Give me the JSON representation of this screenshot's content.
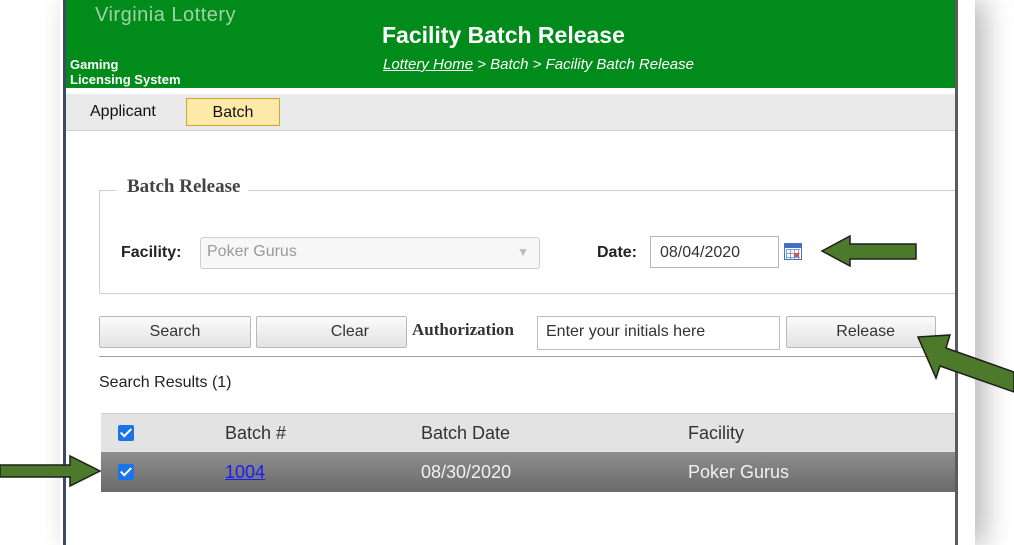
{
  "header": {
    "brand_top": "Virginia Lottery",
    "brand_sub_line1": "Gaming",
    "brand_sub_line2": "Licensing System",
    "page_title": "Facility Batch Release",
    "breadcrumb_home": "Lottery Home",
    "breadcrumb_rest": " > Batch > Facility Batch Release"
  },
  "menu": {
    "items": [
      {
        "label": "Applicant"
      },
      {
        "label": "Batch",
        "active": true
      }
    ]
  },
  "batch_release": {
    "legend": "Batch Release",
    "facility_label": "Facility:",
    "facility_value": "Poker Gurus",
    "date_label": "Date:",
    "date_value": "08/04/2020"
  },
  "actions": {
    "search_label": "Search",
    "clear_label": "Clear",
    "authorization_label": "Authorization",
    "authorization_placeholder": "Enter your initials here",
    "release_label": "Release"
  },
  "results": {
    "summary": "Search Results (1)",
    "columns": [
      "Batch #",
      "Batch Date",
      "Facility"
    ],
    "rows": [
      {
        "selected": true,
        "batch_number": "1004",
        "batch_date": "08/30/2020",
        "facility": "Poker Gurus"
      }
    ],
    "select_all": true
  },
  "colors": {
    "header_green": "#008b1a",
    "active_tab": "#ffe9a8",
    "arrow_green": "#4c7a2a",
    "checkbox_blue": "#1a73e8"
  },
  "icons": [
    "calendar-icon",
    "chevron-down-icon",
    "checkbox-checked-icon",
    "arrow-annotation"
  ]
}
